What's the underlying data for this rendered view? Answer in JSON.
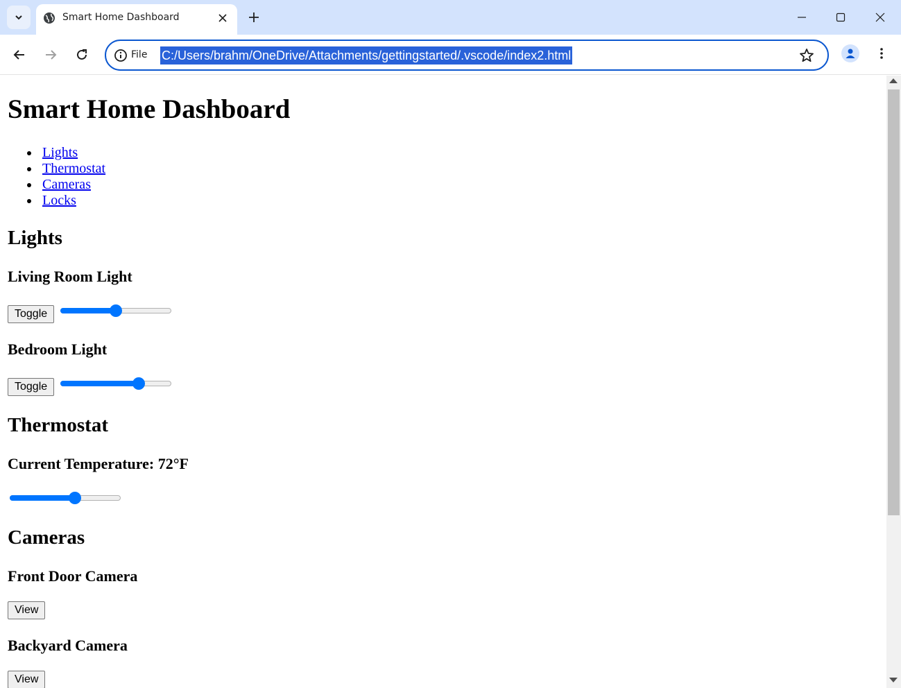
{
  "browser": {
    "tab_title": "Smart Home Dashboard",
    "address_scheme_label": "File",
    "url": "C:/Users/brahm/OneDrive/Attachments/gettingstarted/.vscode/index2.html"
  },
  "page": {
    "title": "Smart Home Dashboard",
    "nav": [
      "Lights",
      "Thermostat",
      "Cameras",
      "Locks"
    ],
    "lights": {
      "heading": "Lights",
      "devices": [
        {
          "name": "Living Room Light",
          "button": "Toggle",
          "brightness_fraction": 0.5
        },
        {
          "name": "Bedroom Light",
          "button": "Toggle",
          "brightness_fraction": 0.73
        }
      ]
    },
    "thermostat": {
      "heading": "Thermostat",
      "current": "Current Temperature: 72°F",
      "slider_fraction": 0.6
    },
    "cameras": {
      "heading": "Cameras",
      "devices": [
        {
          "name": "Front Door Camera",
          "button": "View"
        },
        {
          "name": "Backyard Camera",
          "button": "View"
        }
      ]
    }
  }
}
